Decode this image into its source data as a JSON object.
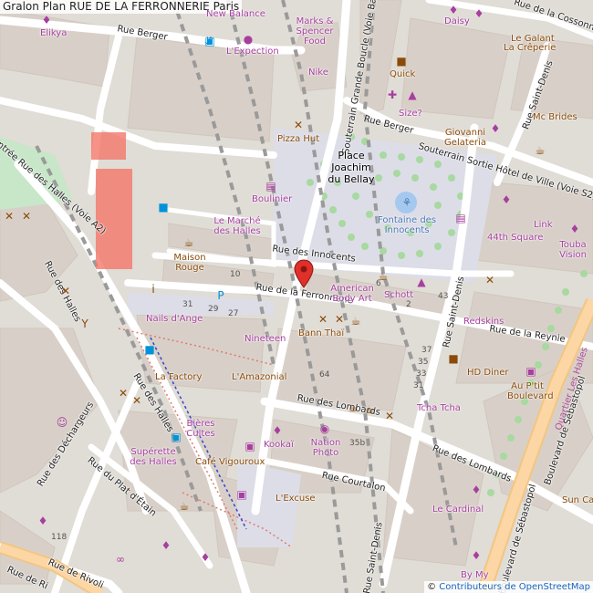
{
  "title": "Gralon Plan RUE DE LA FERRONNERIE Paris",
  "attribution": {
    "prefix": "©",
    "link": "Contributeurs de OpenStreetMap"
  },
  "colors": {
    "background": "#e0dcd6",
    "building": "#d8d0c8",
    "road": "#ffffff",
    "pedestrian": "#dddde8",
    "park": "#c8e6c8",
    "tree": "#a8d9a0",
    "primary": "#fcd6a4",
    "marker": "#e0302a",
    "shop": "#a73ea0",
    "food": "#8a4b08",
    "transport": "#0092da"
  },
  "marker_icon": "location-pin-icon",
  "streets": [
    "Rue Berger",
    "Entrée Rue des Halles (Voie A2)",
    "Rue des Halles",
    "Rue des Innocents",
    "Rue de la Ferronnerie",
    "Souterrain Grande Boucle (Voie Basse)",
    "Rue de la Cossonnerie",
    "Rue Saint-Denis",
    "Rue Berger",
    "Souterrain Sortie Hôtel de Ville (Voie S2)",
    "Rue Saint-Denis",
    "Rue de la Reynie",
    "Rue des Halles",
    "Rue des Déchargeurs",
    "Rue du Plat d'Étain",
    "Rue des Lombards",
    "Rue des Lombards",
    "Rue Courtalon",
    "Rue Saint-Denis",
    "Boulevard de Sébastopol",
    "Boulevard de Sébastopol",
    "Rue de Rivoli",
    "Rue de Ri"
  ],
  "place_name": "Place Joachim du Bellay",
  "fountain": "Fontaine des Innocents",
  "quarter": "Quartier Les Halles",
  "pois": [
    "Gralon",
    "Elikya",
    "New Balance",
    "Marks & Spencer Food",
    "L'Expection",
    "Nike",
    "Daisy",
    "Le Galant",
    "La Crêperie",
    "Quick",
    "Size?",
    "Giovanni Gelateria",
    "Mc Brides",
    "Pizza Hut",
    "Boulinier",
    "Le Marché des Halles",
    "Link",
    "44th Square",
    "Touba Vision",
    "Maison Rouge",
    "American Body Art",
    "Schott",
    "Redskins",
    "Nails d'Ange",
    "Nineteen",
    "Bann Thaï",
    "HD Diner",
    "Au P'tit Boulevard",
    "La Factory",
    "L'Amazonial",
    "Tcha Tcha",
    "Bières Cultes",
    "Kookaï",
    "Nation Photo",
    "Supérette des Halles",
    "Café Vigouroux",
    "L'Excuse",
    "Le Cardinal",
    "Sun Ca",
    "By My"
  ],
  "house_numbers": [
    "10",
    "6",
    "31",
    "29",
    "27",
    "2",
    "43",
    "37",
    "35",
    "33",
    "31",
    "64",
    "35b",
    "118"
  ]
}
